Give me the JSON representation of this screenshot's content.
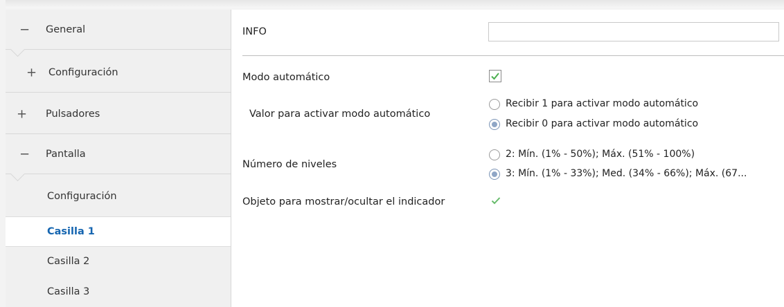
{
  "sidebar": {
    "items": [
      {
        "sign": "−",
        "label": "General"
      },
      {
        "sign": "+",
        "label": "Configuración"
      },
      {
        "sign": "+",
        "label": "Pulsadores"
      },
      {
        "sign": "−",
        "label": "Pantalla"
      }
    ],
    "subitems": [
      {
        "label": "Configuración",
        "active": false
      },
      {
        "label": "Casilla 1",
        "active": true
      },
      {
        "label": "Casilla 2",
        "active": false
      },
      {
        "label": "Casilla 3",
        "active": false
      }
    ]
  },
  "main": {
    "info_label": "INFO",
    "info_value": "",
    "auto_mode": {
      "label": "Modo automático",
      "checked": true
    },
    "activate_value": {
      "label": "Valor para activar modo automático",
      "options": [
        "Recibir 1 para activar modo automático",
        "Recibir 0 para activar modo automático"
      ],
      "selected": 1
    },
    "levels": {
      "label": "Número de niveles",
      "options": [
        "2: Mín. (1% - 50%); Máx. (51% - 100%)",
        "3: Mín. (1% - 33%); Med. (34% - 66%); Máx. (67..."
      ],
      "selected": 1
    },
    "indicator": {
      "label": "Objeto para mostrar/ocultar el indicador",
      "checked": true
    }
  },
  "colors": {
    "accent": "#1565b0",
    "check": "#4caf50"
  }
}
